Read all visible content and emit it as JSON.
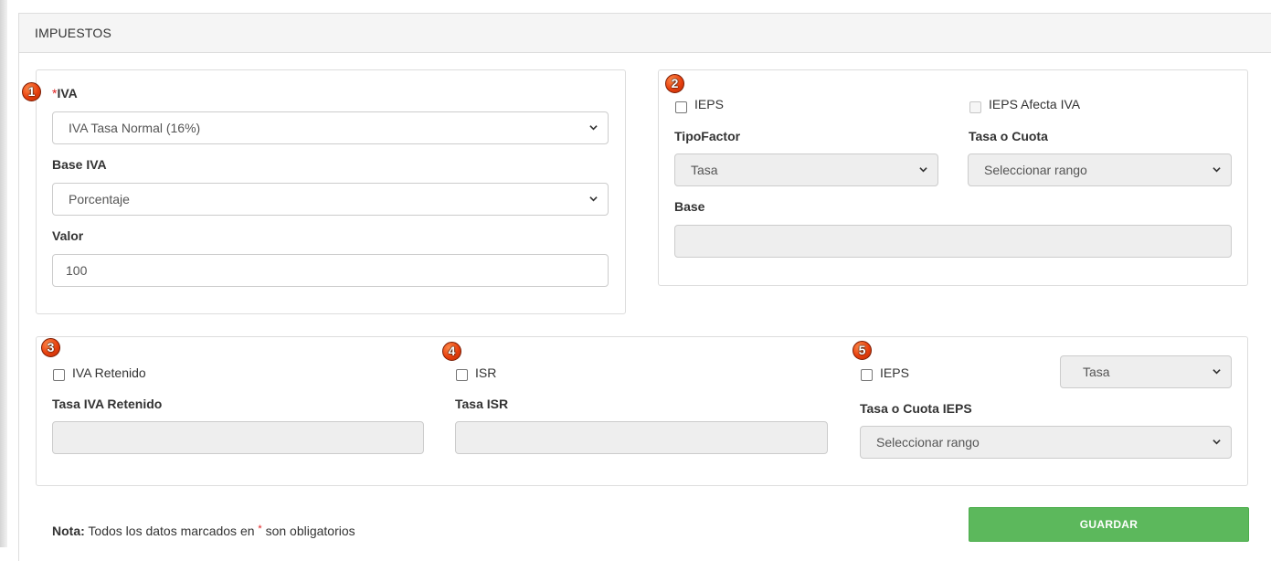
{
  "panel": {
    "title": "IMPUESTOS"
  },
  "badges": [
    "1",
    "2",
    "3",
    "4",
    "5"
  ],
  "iva": {
    "required_mark": "*",
    "label": "IVA",
    "selected": "IVA Tasa Normal (16%)",
    "base_label": "Base IVA",
    "base_selected": "Porcentaje",
    "valor_label": "Valor",
    "valor_value": "100"
  },
  "ieps": {
    "checkbox_label": "IEPS",
    "afecta_label": "IEPS Afecta IVA",
    "tipo_factor_label": "TipoFactor",
    "tipo_factor_selected": "Tasa",
    "tasa_cuota_label": "Tasa o Cuota",
    "tasa_cuota_selected": "Seleccionar rango",
    "base_label": "Base",
    "base_value": ""
  },
  "retenciones": {
    "iva_ret_checkbox": "IVA Retenido",
    "iva_ret_label": "Tasa IVA Retenido",
    "iva_ret_value": "",
    "isr_checkbox": "ISR",
    "isr_label": "Tasa ISR",
    "isr_value": "",
    "ieps_checkbox": "IEPS",
    "ieps_tipo_selected": "Tasa",
    "ieps_tasa_label": "Tasa o Cuota IEPS",
    "ieps_tasa_selected": "Seleccionar rango"
  },
  "footer": {
    "note_bold": "Nota:",
    "note_text": " Todos los datos marcados en ",
    "note_star": "*",
    "note_end": " son obligatorios",
    "save_label": "GUARDAR"
  },
  "colors": {
    "accent_green": "#5cb85c",
    "required_red": "#e02020",
    "badge_orange": "#e8400e"
  }
}
